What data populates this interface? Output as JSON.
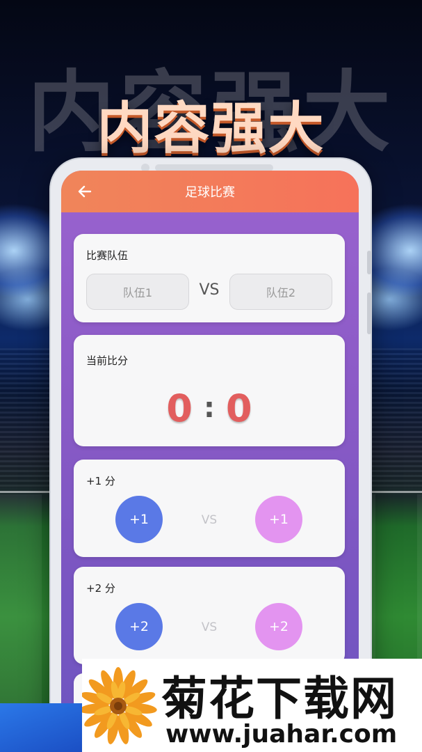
{
  "promo": {
    "shadow_title": "内容强大",
    "title": "内容强大"
  },
  "app": {
    "title": "足球比赛",
    "back_icon": "arrow-left-icon"
  },
  "teams_card": {
    "label": "比赛队伍",
    "team1_placeholder": "队伍1",
    "vs": "VS",
    "team2_placeholder": "队伍2"
  },
  "score_card": {
    "label": "当前比分",
    "left_score": "0",
    "separator": ":",
    "right_score": "0"
  },
  "plus1_card": {
    "label": "+1 分",
    "left_button": "+1",
    "vs": "VS",
    "right_button": "+1"
  },
  "plus2_card": {
    "label": "+2 分",
    "left_button": "+2",
    "vs": "VS",
    "right_button": "+2"
  },
  "watermark": {
    "name": "菊花下载网",
    "url": "www.juahar.com",
    "logo_icon": "flower-icon"
  },
  "colors": {
    "appbar": "#f6725a",
    "score": "#e25e5e",
    "team_blue": "#5a79e6",
    "team_pink": "#e394f0",
    "screen_bg": "#8a5ac6"
  }
}
